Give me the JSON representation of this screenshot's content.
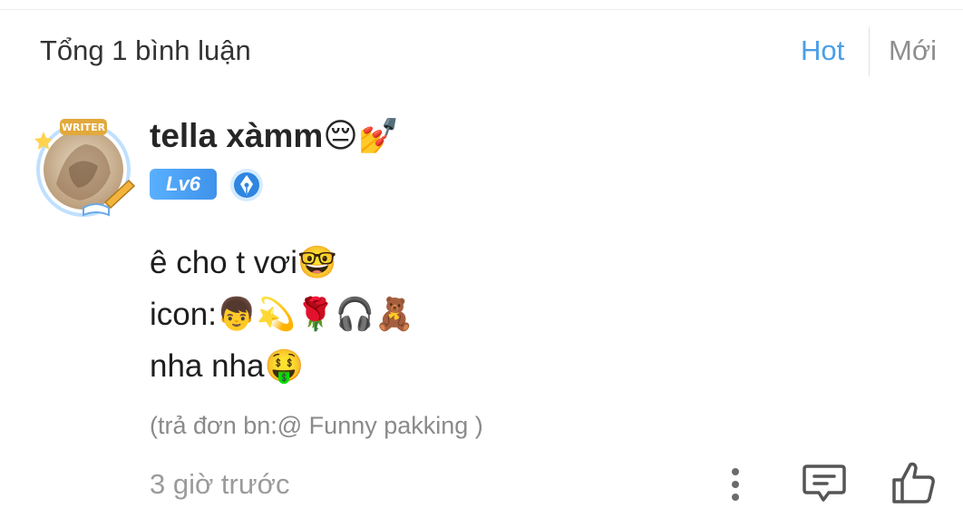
{
  "header": {
    "count_title": "Tổng 1 bình luận",
    "sort_tabs": [
      {
        "label": "Hot",
        "active": true,
        "color": "#4a9fe6"
      },
      {
        "label": "Mới",
        "active": false,
        "color": "#8e8e8e"
      }
    ]
  },
  "comment": {
    "avatar_badge_text": "WRITER",
    "username": "tella xàmm",
    "username_emojis": "😔💅",
    "level_badge": "Lv6",
    "level_badge_color": "#4a9fe6",
    "writer_badge_icon": "pen-nib-icon",
    "content_lines": [
      {
        "text": "ê cho t vơi",
        "emojis": "🤓"
      },
      {
        "text": "icon:",
        "emojis": "👦💫🌹🎧🧸"
      },
      {
        "text": "nha nha",
        "emojis": "🤑"
      }
    ],
    "reply_note": "(trả đơn bn:@ Funny pakking )",
    "timestamp": "3 giờ trước",
    "actions": {
      "more_icon": "more-vertical-icon",
      "reply_icon": "comment-icon",
      "like_icon": "thumbs-up-icon"
    }
  }
}
